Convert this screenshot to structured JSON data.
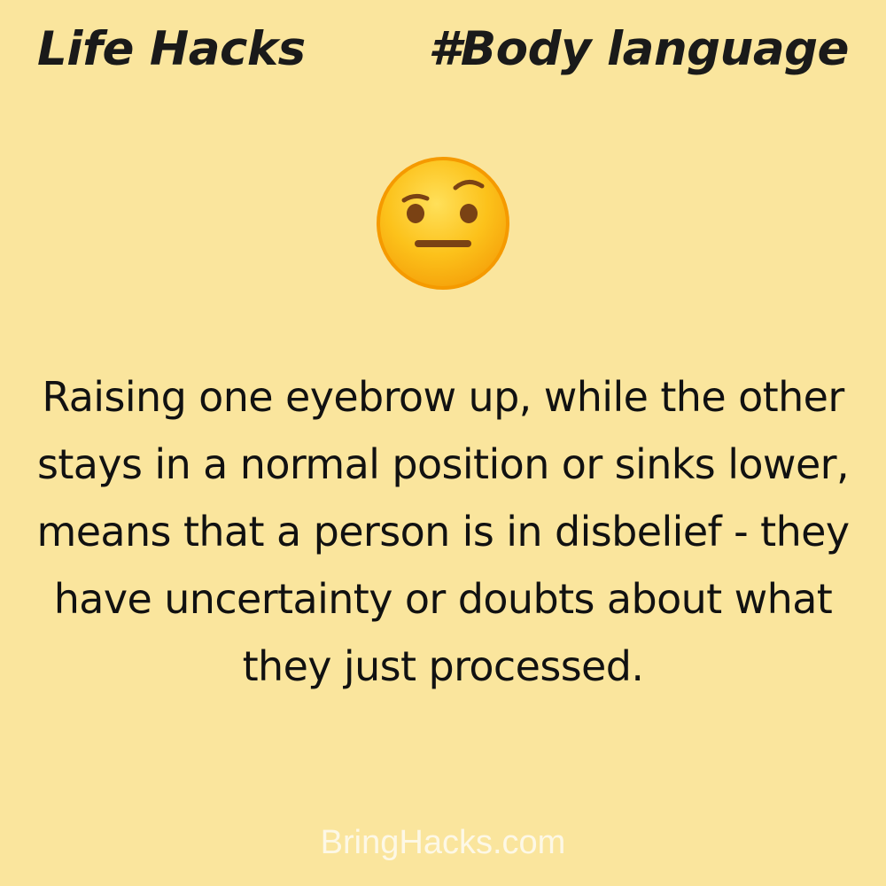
{
  "header": {
    "left_title": "Life Hacks",
    "right_title": "#Body language"
  },
  "emoji": {
    "icon": "raised-eyebrow-face-emoji",
    "colors": {
      "face": "#fcc21b",
      "outline": "#f59a00",
      "features": "#7a4214"
    }
  },
  "content": {
    "text": "Raising one eyebrow up, while the other stays in a normal position or sinks lower, means that a person is in disbelief - they have uncertainty or doubts about what they just processed."
  },
  "footer": {
    "site": "BringHacks.com"
  },
  "colors": {
    "background": "#fae59d",
    "title": "#1a1a1a",
    "body_text": "#111111",
    "footer_text": "#fdf8e6"
  }
}
